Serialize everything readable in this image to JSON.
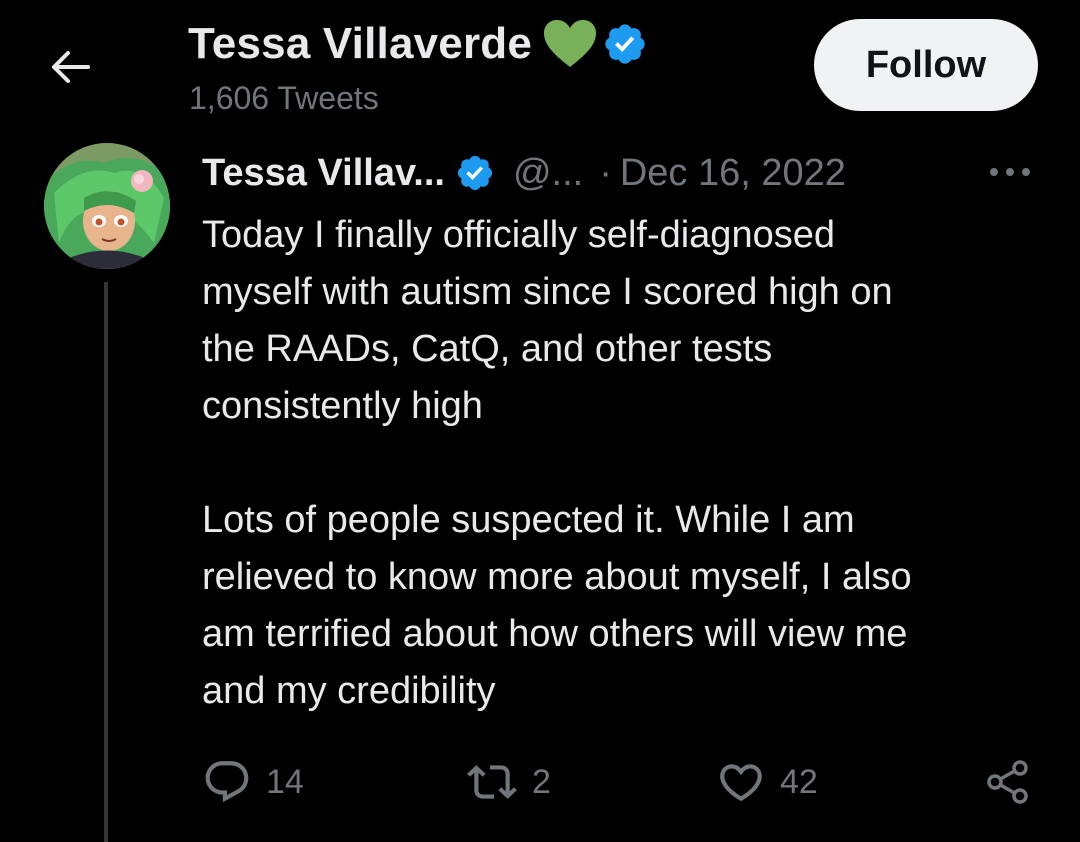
{
  "header": {
    "name": "Tessa Villaverde",
    "tweet_count": "1,606 Tweets",
    "follow_label": "Follow",
    "icons": [
      "back-arrow-icon",
      "green-heart-icon",
      "verified-badge-icon"
    ]
  },
  "tweet": {
    "author_name": "Tessa Villav...",
    "handle": "@...",
    "separator": "·",
    "date": "Dec 16, 2022",
    "paragraphs": [
      "Today I finally officially self-diagnosed\nmyself with autism since I scored high on\nthe RAADs, CatQ, and other tests\nconsistently high",
      "Lots of people suspected it. While I am\nrelieved to know more about myself, I also\nam terrified about how others will view me\nand my credibility"
    ],
    "replies": "14",
    "retweets": "2",
    "likes": "42"
  },
  "colors": {
    "background": "#000000",
    "text_primary": "#e7e9ea",
    "text_secondary": "#71767b",
    "verified_blue": "#1d9bf0",
    "heart_green": "#78b159",
    "follow_bg": "#eff3f4",
    "thread_line": "#333639"
  }
}
